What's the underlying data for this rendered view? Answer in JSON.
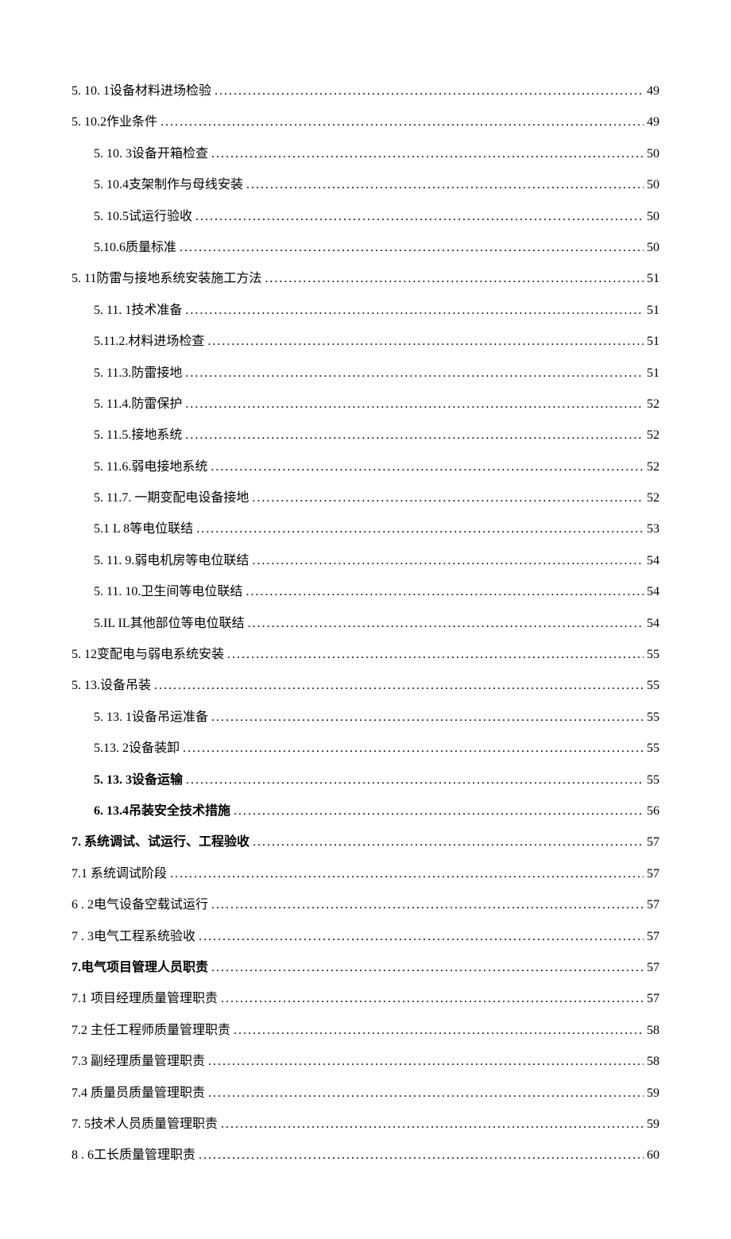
{
  "toc": [
    {
      "label": "5. 10. 1设备材料进场检验",
      "page": "49",
      "indent": 0,
      "bold": false
    },
    {
      "label": "5. 10.2作业条件",
      "page": "49",
      "indent": 0,
      "bold": false
    },
    {
      "label": "5. 10. 3设备开箱检查",
      "page": "50",
      "indent": 1,
      "bold": false
    },
    {
      "label": "5. 10.4支架制作与母线安装",
      "page": "50",
      "indent": 1,
      "bold": false
    },
    {
      "label": "5. 10.5试运行验收",
      "page": "50",
      "indent": 1,
      "bold": false
    },
    {
      "label": "5.10.6质量标准",
      "page": "50",
      "indent": 1,
      "bold": false
    },
    {
      "label": "5. 11防雷与接地系统安装施工方法",
      "page": "51",
      "indent": 0,
      "bold": false
    },
    {
      "label": "5. 11. 1技术准备",
      "page": "51",
      "indent": 1,
      "bold": false
    },
    {
      "label": "5.11.2.材料进场检查",
      "page": "51",
      "indent": 1,
      "bold": false
    },
    {
      "label": "5. 11.3.防雷接地",
      "page": "51",
      "indent": 1,
      "bold": false
    },
    {
      "label": "5. 11.4.防雷保护",
      "page": "52",
      "indent": 1,
      "bold": false
    },
    {
      "label": "5. 11.5.接地系统",
      "page": "52",
      "indent": 1,
      "bold": false
    },
    {
      "label": "5. 11.6.弱电接地系统",
      "page": "52",
      "indent": 1,
      "bold": false
    },
    {
      "label": "5. 11.7. 一期变配电设备接地",
      "page": "52",
      "indent": 1,
      "bold": false
    },
    {
      "label": "5.1 L 8等电位联结",
      "page": "53",
      "indent": 1,
      "bold": false
    },
    {
      "label": "5. 11. 9.弱电机房等电位联结",
      "page": "54",
      "indent": 1,
      "bold": false
    },
    {
      "label": "5. 11. 10.卫生间等电位联结",
      "page": "54",
      "indent": 1,
      "bold": false
    },
    {
      "label": "5.IL IL其他部位等电位联结",
      "page": "54",
      "indent": 1,
      "bold": false
    },
    {
      "label": "5. 12变配电与弱电系统安装",
      "page": "55",
      "indent": 0,
      "bold": false
    },
    {
      "label": "5. 13.设备吊装",
      "page": "55",
      "indent": 0,
      "bold": false
    },
    {
      "label": "5. 13. 1设备吊运准备",
      "page": "55",
      "indent": 1,
      "bold": false
    },
    {
      "label": "5.13. 2设备装卸",
      "page": "55",
      "indent": 1,
      "bold": false
    },
    {
      "label": "5. 13. 3设备运输",
      "page": "55",
      "indent": 1,
      "bold": true
    },
    {
      "label": "6. 13.4吊装安全技术措施",
      "page": "56",
      "indent": 1,
      "bold": true
    },
    {
      "label": "7. 系统调试、试运行、工程验收",
      "page": "57",
      "indent": 0,
      "bold": true
    },
    {
      "label": "7.1 系统调试阶段",
      "page": "57",
      "indent": 0,
      "bold": false
    },
    {
      "label": "6 . 2电气设备空载试运行",
      "page": "57",
      "indent": 0,
      "bold": false
    },
    {
      "label": "7 . 3电气工程系统验收",
      "page": "57",
      "indent": 0,
      "bold": false
    },
    {
      "label": "7.电气项目管理人员职责",
      "page": "57",
      "indent": 0,
      "bold": true
    },
    {
      "label": "7.1 项目经理质量管理职责",
      "page": "57",
      "indent": 0,
      "bold": false
    },
    {
      "label": "7.2 主任工程师质量管理职责",
      "page": "58",
      "indent": 0,
      "bold": false
    },
    {
      "label": "7.3 副经理质量管理职责",
      "page": "58",
      "indent": 0,
      "bold": false
    },
    {
      "label": "7.4 质量员质量管理职责",
      "page": "59",
      "indent": 0,
      "bold": false
    },
    {
      "label": "7. 5技术人员质量管理职责",
      "page": "59",
      "indent": 0,
      "bold": false
    },
    {
      "label": "8 . 6工长质量管理职责",
      "page": "60",
      "indent": 0,
      "bold": false
    }
  ]
}
